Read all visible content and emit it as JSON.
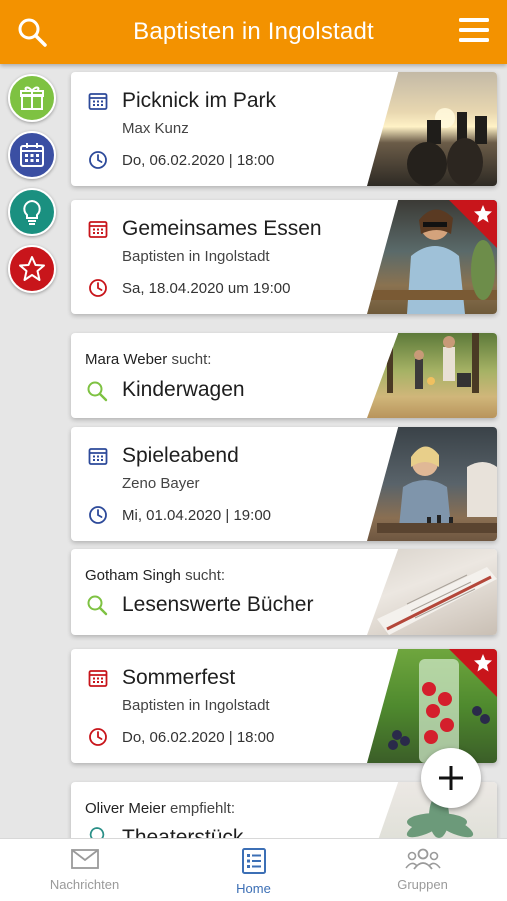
{
  "header": {
    "title": "Baptisten in Ingolstadt"
  },
  "colors": {
    "accent": "#f39200",
    "navy": "#2d4a9a",
    "red": "#c8151b",
    "green": "#7ec242",
    "teal": "#2a8f87"
  },
  "side_rail": [
    {
      "icon": "gift-icon",
      "color": "#7ec242"
    },
    {
      "icon": "calendar-icon",
      "color": "#3b4fa3"
    },
    {
      "icon": "lightbulb-icon",
      "color": "#1a9080"
    },
    {
      "icon": "star-icon",
      "color": "#c8151b"
    }
  ],
  "feed": {
    "card1": {
      "title": "Picknick im Park",
      "organizer": "Max Kunz",
      "datetime": "Do, 06.02.2020 | 18:00"
    },
    "card2": {
      "title": "Gemeinsames Essen",
      "organizer": "Baptisten in Ingolstadt",
      "datetime": "Sa, 18.04.2020 um 19:00",
      "featured": true
    },
    "card3": {
      "user": "Mara Weber",
      "action": "sucht:",
      "title": "Kinderwagen"
    },
    "card4": {
      "title": "Spieleabend",
      "organizer": "Zeno Bayer",
      "datetime": "Mi, 01.04.2020 | 19:00"
    },
    "card5": {
      "user": "Gotham Singh",
      "action": "sucht:",
      "title": "Lesenswerte Bücher"
    },
    "card6": {
      "title": "Sommerfest",
      "organizer": "Baptisten in Ingolstadt",
      "datetime": "Do, 06.02.2020 | 18:00",
      "featured": true
    },
    "card7": {
      "user": "Oliver Meier",
      "action": "empfiehlt:",
      "title": "Theaterstück"
    }
  },
  "bottom_nav": {
    "messages": "Nachrichten",
    "home": "Home",
    "groups": "Gruppen",
    "active": "home"
  }
}
